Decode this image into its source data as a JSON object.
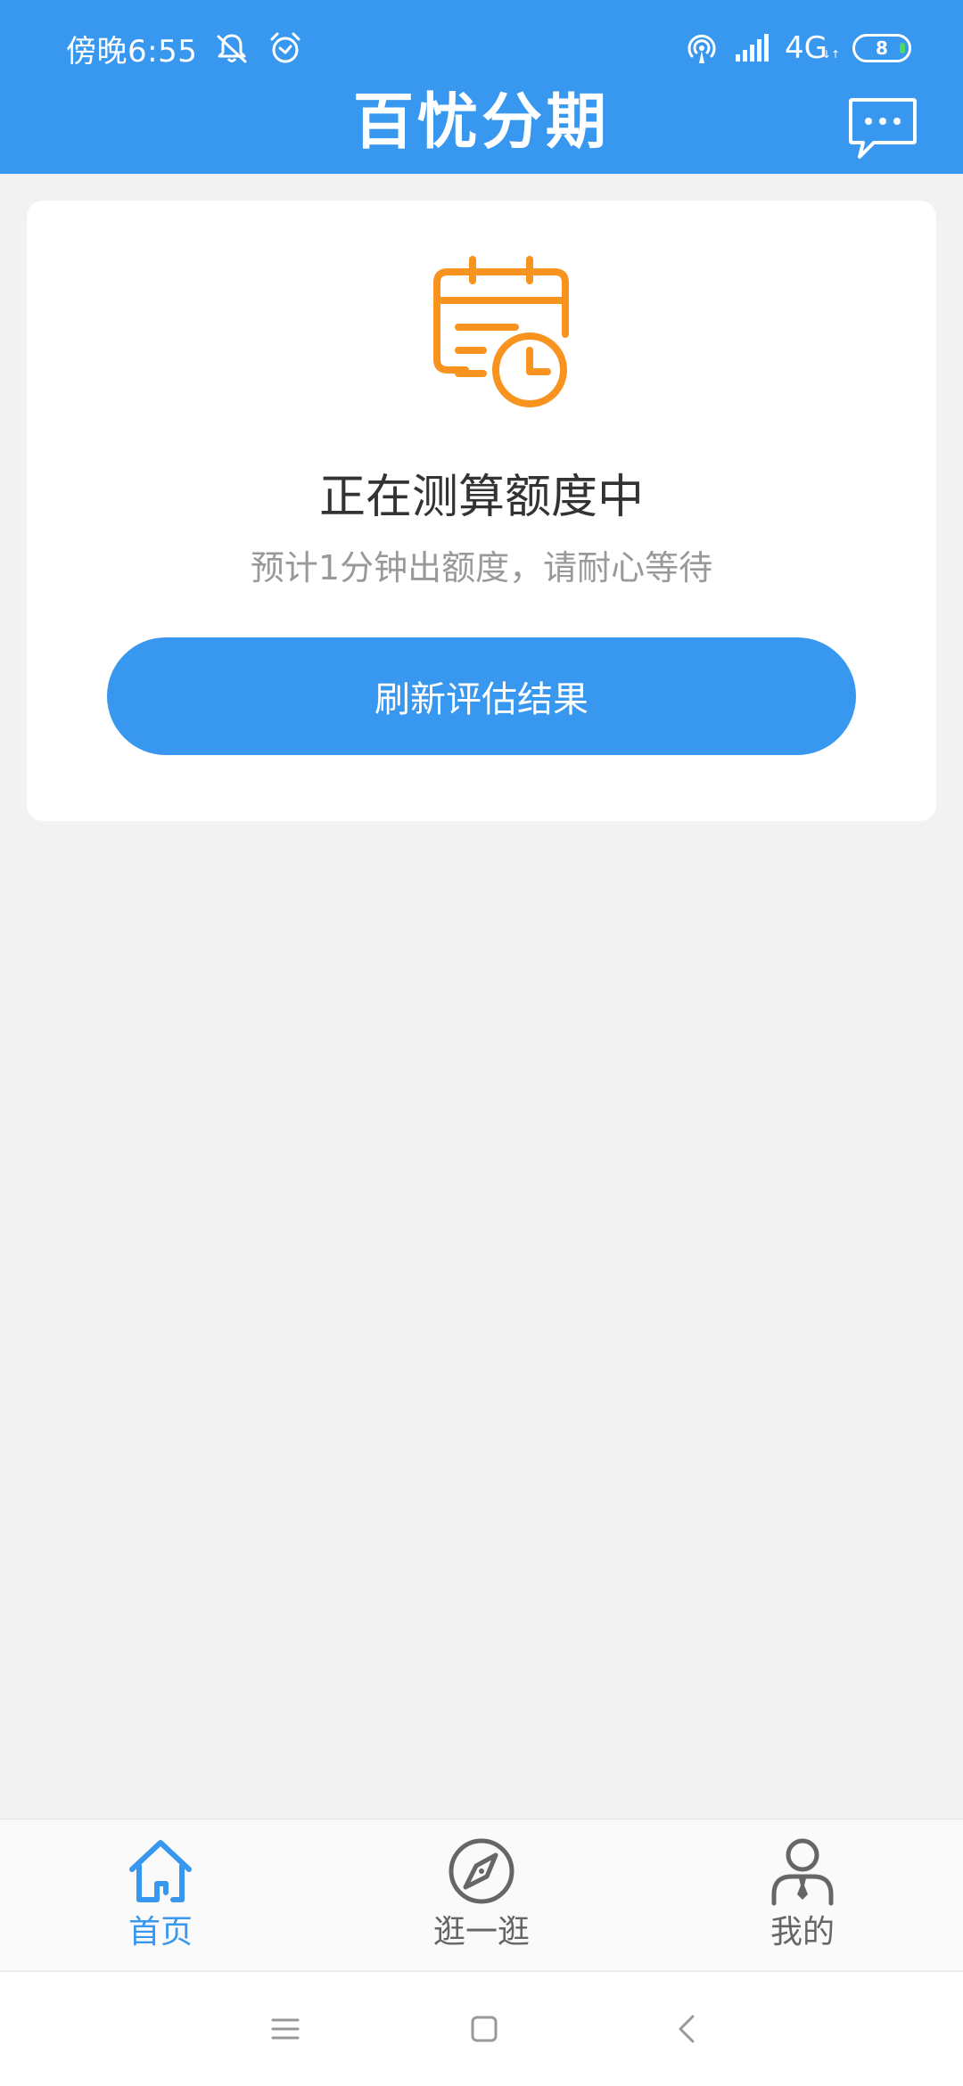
{
  "status_bar": {
    "time": "傍晚6:55",
    "network": "4G",
    "network_sub": "↓↑",
    "battery": "8",
    "icons": [
      "mute-notification-icon",
      "alarm-icon",
      "hotspot-icon",
      "signal-icon",
      "battery-icon"
    ]
  },
  "header": {
    "title": "百忧分期",
    "message_icon": "chat-bubble-icon"
  },
  "card": {
    "icon": "calendar-clock-icon",
    "title": "正在测算额度中",
    "subtitle": "预计1分钟出额度，请耐心等待",
    "button_label": "刷新评估结果"
  },
  "tabbar": {
    "items": [
      {
        "label": "首页",
        "icon": "home-icon",
        "active": true
      },
      {
        "label": "逛一逛",
        "icon": "compass-icon",
        "active": false
      },
      {
        "label": "我的",
        "icon": "user-icon",
        "active": false
      }
    ]
  },
  "navbar": {
    "icons": [
      "menu-icon",
      "home-square-icon",
      "back-icon"
    ]
  },
  "colors": {
    "primary": "#3897ef",
    "accent_orange": "#f7931e",
    "background": "#f2f2f2",
    "title_text": "#333333",
    "subtitle_text": "#999999",
    "tab_inactive": "#666666"
  }
}
